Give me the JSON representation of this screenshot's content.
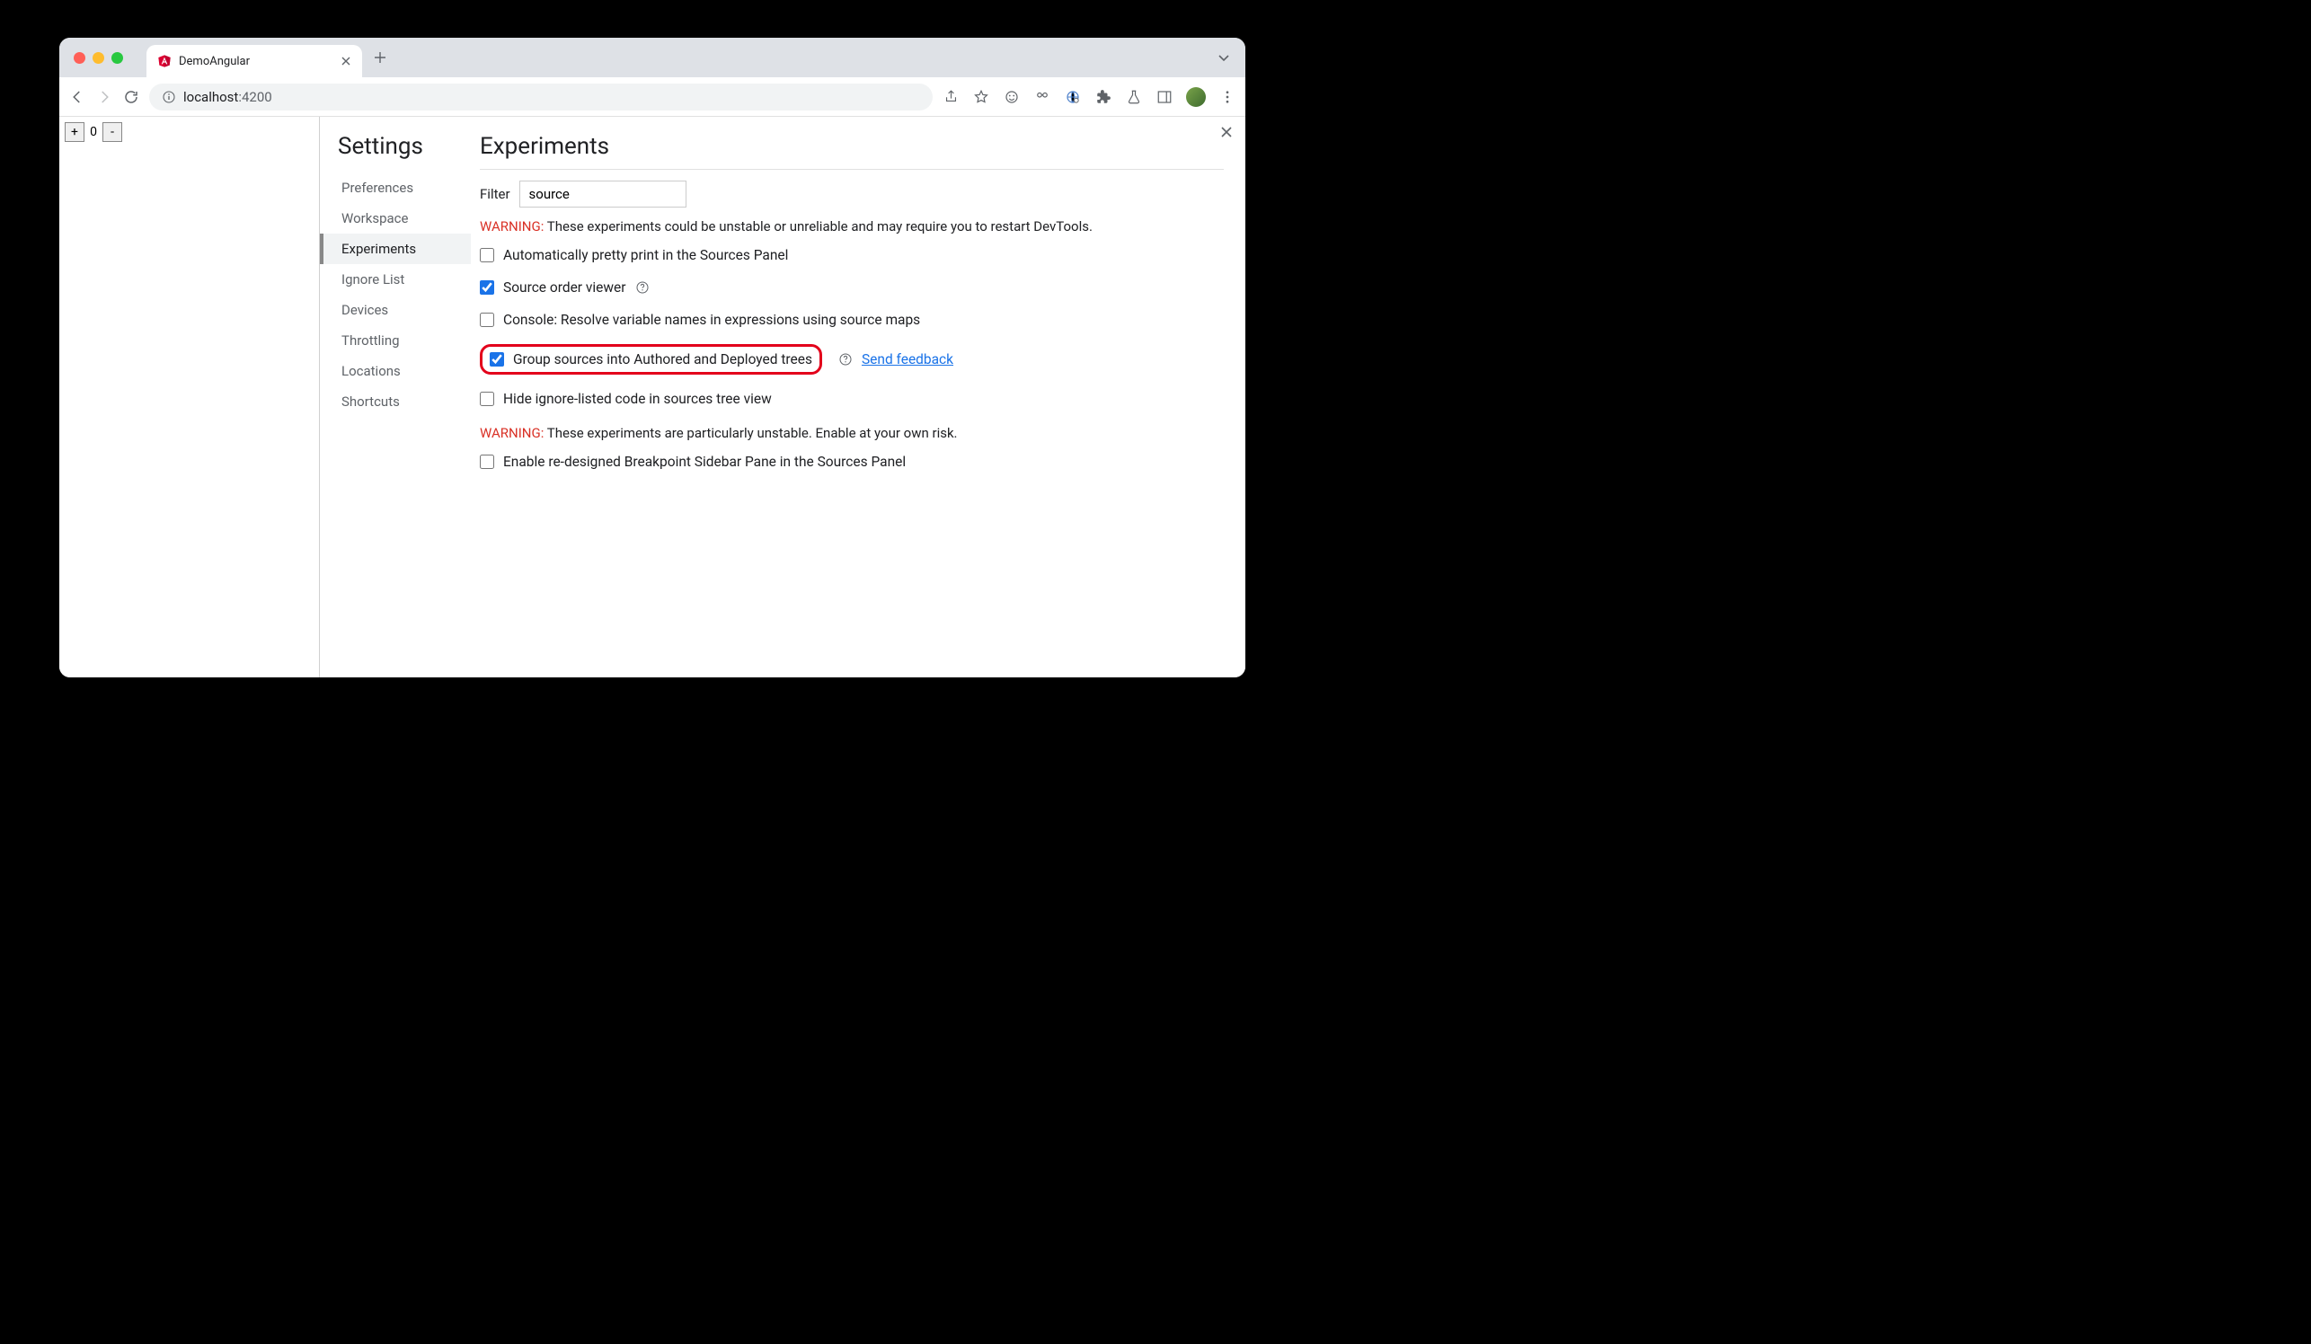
{
  "browser": {
    "tab_title": "DemoAngular",
    "url_host": "localhost",
    "url_port": ":4200"
  },
  "page": {
    "counter_value": "0",
    "plus_label": "+",
    "minus_label": "-"
  },
  "settings": {
    "title": "Settings",
    "items": [
      "Preferences",
      "Workspace",
      "Experiments",
      "Ignore List",
      "Devices",
      "Throttling",
      "Locations",
      "Shortcuts"
    ],
    "active_index": 2
  },
  "main": {
    "title": "Experiments",
    "filter_label": "Filter",
    "filter_value": "source",
    "warning1_label": "WARNING:",
    "warning1_text": " These experiments could be unstable or unreliable and may require you to restart DevTools.",
    "warning2_label": "WARNING:",
    "warning2_text": " These experiments are particularly unstable. Enable at your own risk.",
    "send_feedback": "Send feedback",
    "experiments": [
      {
        "label": "Automatically pretty print in the Sources Panel",
        "checked": false,
        "help": false
      },
      {
        "label": "Source order viewer",
        "checked": true,
        "help": true
      },
      {
        "label": "Console: Resolve variable names in expressions using source maps",
        "checked": false,
        "help": false
      },
      {
        "label": "Group sources into Authored and Deployed trees",
        "checked": true,
        "help": true,
        "highlight": true,
        "feedback": true
      },
      {
        "label": "Hide ignore-listed code in sources tree view",
        "checked": false,
        "help": false
      }
    ],
    "unstable_experiments": [
      {
        "label": "Enable re-designed Breakpoint Sidebar Pane in the Sources Panel",
        "checked": false
      }
    ]
  }
}
